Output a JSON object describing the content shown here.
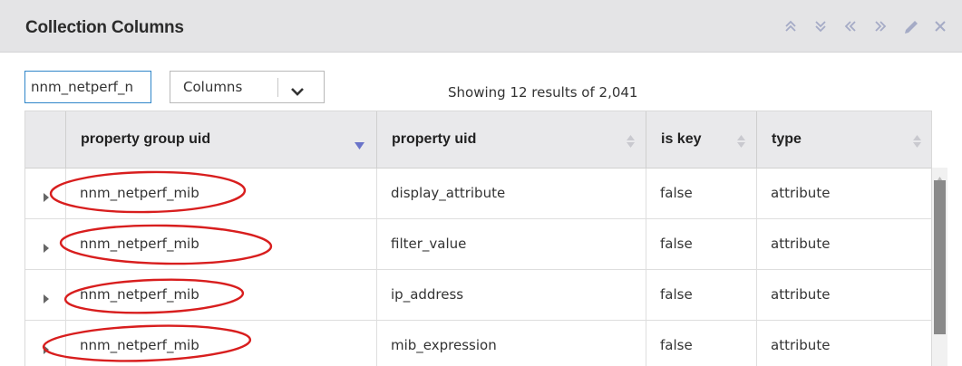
{
  "panel": {
    "title": "Collection Columns",
    "toolbar_icons": [
      "collapse-all-icon",
      "expand-all-icon",
      "previous-icon",
      "next-icon",
      "edit-icon",
      "close-icon"
    ]
  },
  "filter": {
    "value": "nnm_netperf_n",
    "select_value": "Columns"
  },
  "status": {
    "text": "Showing 12 results of 2,041"
  },
  "table": {
    "columns": [
      {
        "label": "property group uid",
        "sort": "descending"
      },
      {
        "label": "property uid",
        "sort": "none"
      },
      {
        "label": "is key",
        "sort": "none"
      },
      {
        "label": "type",
        "sort": "none"
      }
    ],
    "rows": [
      {
        "group": "nnm_netperf_mib",
        "property": "display_attribute",
        "is_key": "false",
        "type": "attribute"
      },
      {
        "group": "nnm_netperf_mib",
        "property": "filter_value",
        "is_key": "false",
        "type": "attribute"
      },
      {
        "group": "nnm_netperf_mib",
        "property": "ip_address",
        "is_key": "false",
        "type": "attribute"
      },
      {
        "group": "nnm_netperf_mib",
        "property": "mib_expression",
        "is_key": "false",
        "type": "attribute"
      }
    ]
  },
  "colors": {
    "titlebar_bg": "#e4e4e6",
    "header_bg": "#e9e9eb",
    "focus_border": "#2f86c9",
    "sort_active": "#6a74c9",
    "annotation": "#d81e1e"
  }
}
